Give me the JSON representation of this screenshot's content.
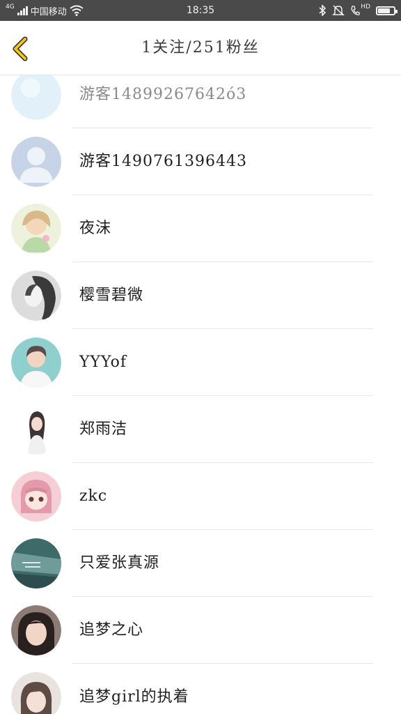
{
  "status_bar": {
    "carrier": "中国移动",
    "network_tag": "4G",
    "time": "18:35",
    "hd_label": "HD",
    "battery_level": 0.75,
    "icons": [
      "signal-icon",
      "wifi-icon",
      "bluetooth-icon",
      "mute-icon",
      "hd-call-icon",
      "battery-icon"
    ]
  },
  "header": {
    "title": "1关注/251粉丝",
    "back_icon": "chevron-left-icon",
    "accent_color": "#f5c518"
  },
  "list": {
    "items": [
      {
        "name": "游客14899267642ó3",
        "avatar": "avatar-light-blue"
      },
      {
        "name": "游客1490761396443",
        "avatar": "avatar-default-silhouette"
      },
      {
        "name": "夜沫",
        "avatar": "avatar-anime-girl"
      },
      {
        "name": "樱雪碧微",
        "avatar": "avatar-grayscale-girl"
      },
      {
        "name": "YYYof",
        "avatar": "avatar-boy-photo"
      },
      {
        "name": "郑雨洁",
        "avatar": "avatar-girl-photo"
      },
      {
        "name": "zkc",
        "avatar": "avatar-pink-anime"
      },
      {
        "name": "只爱张真源",
        "avatar": "avatar-teal-scene"
      },
      {
        "name": "追梦之心",
        "avatar": "avatar-dark-hair-girl"
      },
      {
        "name": "追梦girl的执着",
        "avatar": "avatar-girl-portrait"
      }
    ]
  }
}
